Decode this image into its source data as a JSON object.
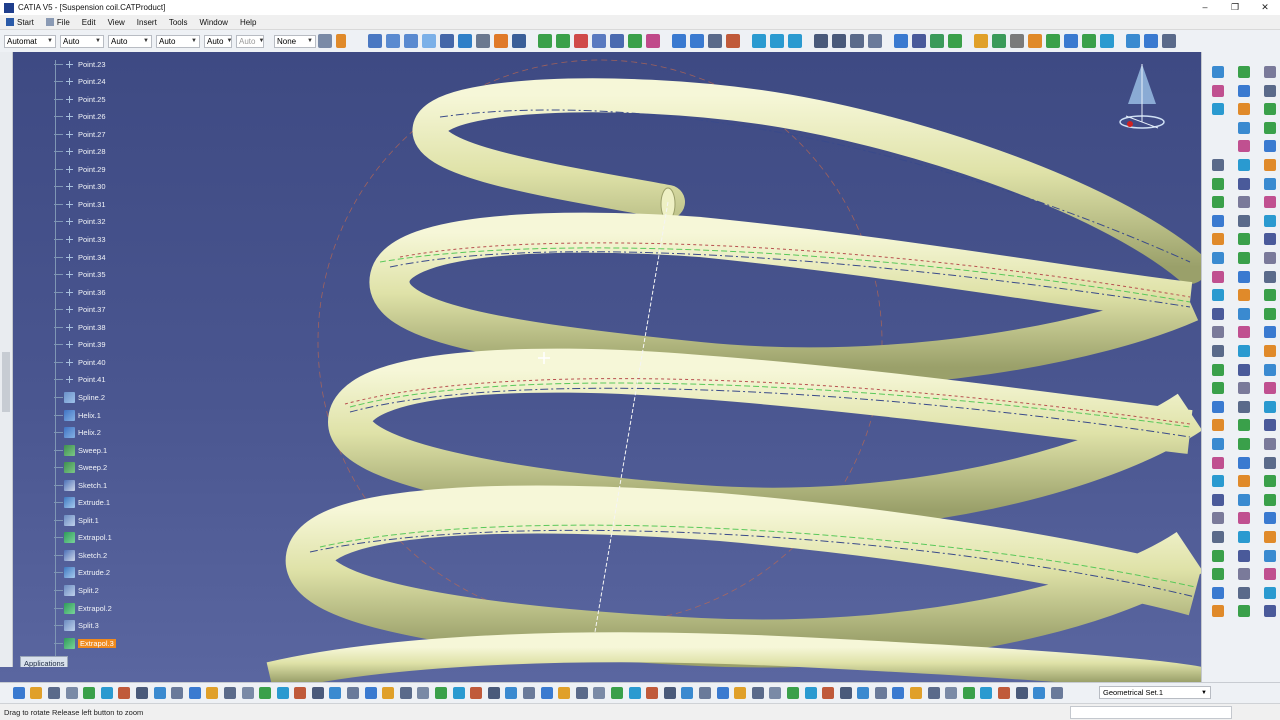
{
  "window": {
    "title": "CATIA V5 - [Suspension coil.CATProduct]",
    "buttons": [
      "–",
      "❐",
      "✕"
    ]
  },
  "menu": [
    "Start",
    "File",
    "Edit",
    "View",
    "Insert",
    "Tools",
    "Window",
    "Help"
  ],
  "toolbar": {
    "combos": [
      "Automat",
      "Auto",
      "Auto",
      "Auto",
      "Auto",
      "Auto",
      "None"
    ]
  },
  "tree": {
    "items": [
      {
        "label": "Point.23",
        "icon": "point-icon"
      },
      {
        "label": "Point.24",
        "icon": "point-icon"
      },
      {
        "label": "Point.25",
        "icon": "point-icon"
      },
      {
        "label": "Point.26",
        "icon": "point-icon"
      },
      {
        "label": "Point.27",
        "icon": "point-icon"
      },
      {
        "label": "Point.28",
        "icon": "point-icon"
      },
      {
        "label": "Point.29",
        "icon": "point-icon"
      },
      {
        "label": "Point.30",
        "icon": "point-icon"
      },
      {
        "label": "Point.31",
        "icon": "point-icon"
      },
      {
        "label": "Point.32",
        "icon": "point-icon"
      },
      {
        "label": "Point.33",
        "icon": "point-icon"
      },
      {
        "label": "Point.34",
        "icon": "point-icon"
      },
      {
        "label": "Point.35",
        "icon": "point-icon"
      },
      {
        "label": "Point.36",
        "icon": "point-icon"
      },
      {
        "label": "Point.37",
        "icon": "point-icon"
      },
      {
        "label": "Point.38",
        "icon": "point-icon"
      },
      {
        "label": "Point.39",
        "icon": "point-icon"
      },
      {
        "label": "Point.40",
        "icon": "point-icon"
      },
      {
        "label": "Point.41",
        "icon": "point-icon"
      },
      {
        "label": "Spline.2",
        "icon": "spline-icon"
      },
      {
        "label": "Helix.1",
        "icon": "helix-icon"
      },
      {
        "label": "Helix.2",
        "icon": "helix-icon"
      },
      {
        "label": "Sweep.1",
        "icon": "sweep-icon"
      },
      {
        "label": "Sweep.2",
        "icon": "sweep-icon"
      },
      {
        "label": "Sketch.1",
        "icon": "sketch-icon"
      },
      {
        "label": "Extrude.1",
        "icon": "extrude-icon"
      },
      {
        "label": "Split.1",
        "icon": "split-icon"
      },
      {
        "label": "Extrapol.1",
        "icon": "extrapol-icon"
      },
      {
        "label": "Sketch.2",
        "icon": "sketch-icon"
      },
      {
        "label": "Extrude.2",
        "icon": "extrude-icon"
      },
      {
        "label": "Split.2",
        "icon": "split-icon"
      },
      {
        "label": "Extrapol.2",
        "icon": "extrapol-icon"
      },
      {
        "label": "Split.3",
        "icon": "split-icon"
      },
      {
        "label": "Extrapol.3",
        "icon": "extrapol-icon",
        "selected": true
      }
    ],
    "applications_label": "Applications"
  },
  "bottom": {
    "geometrical_set": "Geometrical Set.1"
  },
  "status": {
    "text": "Drag to rotate  Release left button to zoom"
  },
  "colors": {
    "background_top": "#3e4a83",
    "coil": "#e4e6b4",
    "selection": "#f08a1c"
  }
}
